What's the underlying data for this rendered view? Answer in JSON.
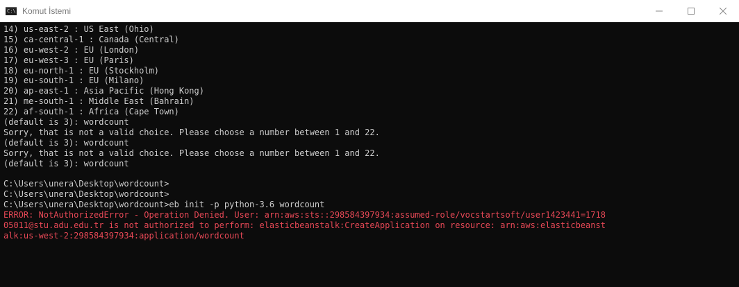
{
  "window": {
    "title": "Komut İstemi",
    "icon": "cmd-icon",
    "icon_glyph": "C:\\",
    "controls": [
      "minimize-icon",
      "maximize-icon",
      "close-icon"
    ]
  },
  "colors": {
    "terminal_bg": "#0c0c0c",
    "terminal_fg": "#cccccc",
    "error_fg": "#e74856"
  },
  "terminal": {
    "lines": [
      {
        "text": "14) us-east-2 : US East (Ohio)",
        "type": "normal"
      },
      {
        "text": "15) ca-central-1 : Canada (Central)",
        "type": "normal"
      },
      {
        "text": "16) eu-west-2 : EU (London)",
        "type": "normal"
      },
      {
        "text": "17) eu-west-3 : EU (Paris)",
        "type": "normal"
      },
      {
        "text": "18) eu-north-1 : EU (Stockholm)",
        "type": "normal"
      },
      {
        "text": "19) eu-south-1 : EU (Milano)",
        "type": "normal"
      },
      {
        "text": "20) ap-east-1 : Asia Pacific (Hong Kong)",
        "type": "normal"
      },
      {
        "text": "21) me-south-1 : Middle East (Bahrain)",
        "type": "normal"
      },
      {
        "text": "22) af-south-1 : Africa (Cape Town)",
        "type": "normal"
      },
      {
        "text": "(default is 3): wordcount",
        "type": "normal"
      },
      {
        "text": "Sorry, that is not a valid choice. Please choose a number between 1 and 22.",
        "type": "normal"
      },
      {
        "text": "(default is 3): wordcount",
        "type": "normal"
      },
      {
        "text": "Sorry, that is not a valid choice. Please choose a number between 1 and 22.",
        "type": "normal"
      },
      {
        "text": "(default is 3): wordcount",
        "type": "normal"
      },
      {
        "text": "",
        "type": "normal"
      },
      {
        "text": "C:\\Users\\unera\\Desktop\\wordcount>",
        "type": "normal"
      },
      {
        "text": "C:\\Users\\unera\\Desktop\\wordcount>",
        "type": "normal"
      },
      {
        "text": "C:\\Users\\unera\\Desktop\\wordcount>eb init -p python-3.6 wordcount",
        "type": "normal"
      },
      {
        "text": "ERROR: NotAuthorizedError - Operation Denied. User: arn:aws:sts::298584397934:assumed-role/vocstartsoft/user1423441=1718",
        "type": "error"
      },
      {
        "text": "05011@stu.adu.edu.tr is not authorized to perform: elasticbeanstalk:CreateApplication on resource: arn:aws:elasticbeanst",
        "type": "error"
      },
      {
        "text": "alk:us-west-2:298584397934:application/wordcount",
        "type": "error"
      }
    ]
  }
}
